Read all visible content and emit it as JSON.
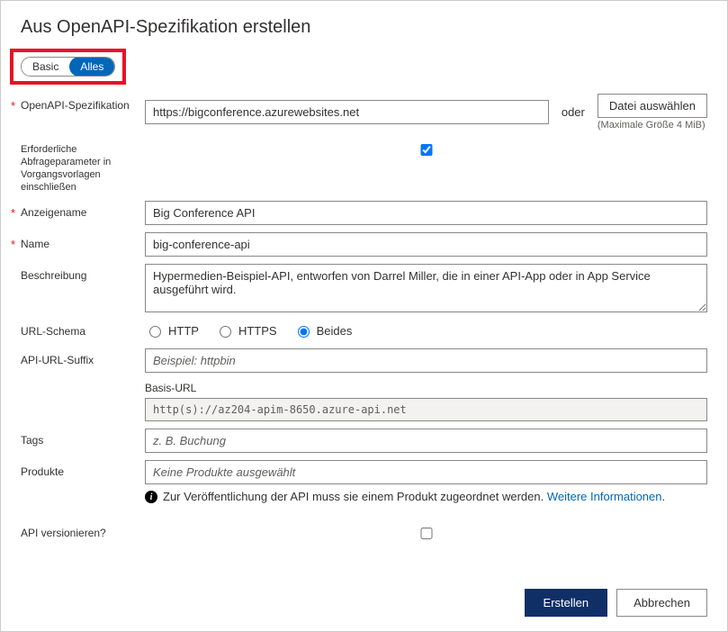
{
  "title": "Aus OpenAPI-Spezifikation erstellen",
  "toggle": {
    "basic": "Basic",
    "all": "Alles"
  },
  "labels": {
    "spec": "OpenAPI-Spezifikation",
    "includeParams": "Erforderliche Abfrageparameter in Vorgangsvorlagen einschließen",
    "displayName": "Anzeigename",
    "name": "Name",
    "description": "Beschreibung",
    "urlScheme": "URL-Schema",
    "apiUrlSuffix": "API-URL-Suffix",
    "baseUrl": "Basis-URL",
    "tags": "Tags",
    "products": "Produkte",
    "versionApi": "API versionieren?",
    "or": "oder",
    "selectFile": "Datei auswählen",
    "maxSize": "(Maximale Größe 4 MiB)"
  },
  "values": {
    "spec": "https://bigconference.azurewebsites.net",
    "includeParams": true,
    "displayName": "Big Conference API",
    "name": "big-conference-api",
    "description": "Hypermedien-Beispiel-API, entworfen von Darrel Miller, die in einer API-App oder in App Service ausgeführt wird.",
    "apiUrlSuffixPlaceholder": "Beispiel: httpbin",
    "baseUrl": "http(s)://az204-apim-8650.azure-api.net",
    "tagsPlaceholder": "z. B. Buchung",
    "productsPlaceholder": "Keine Produkte ausgewählt",
    "versionApi": false
  },
  "scheme": {
    "http": "HTTP",
    "https": "HTTPS",
    "both": "Beides",
    "selected": "both"
  },
  "info": {
    "text": "Zur Veröffentlichung der API muss sie einem Produkt zugeordnet werden.",
    "link": "Weitere Informationen"
  },
  "footer": {
    "create": "Erstellen",
    "cancel": "Abbrechen"
  }
}
